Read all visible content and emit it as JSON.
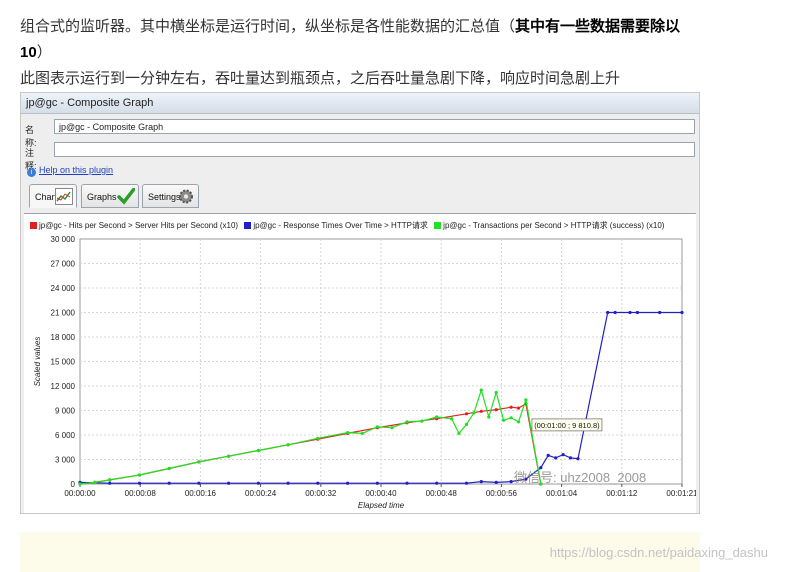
{
  "article": {
    "line1_pre": "组合式的监听器。其中横坐标是运行时间，纵坐标是各性能数据的汇总值（",
    "line1_bold": "其中有一些数据需要除以10",
    "line1_post": "）",
    "line2": "此图表示运行到一分钟左右，吞吐量达到瓶颈点，之后吞吐量急剧下降，响应时间急剧上升"
  },
  "window": {
    "title": "jp@gc - Composite Graph",
    "name_label": "名称:",
    "name_value": "jp@gc - Composite Graph",
    "comment_label": "注释:",
    "comment_value": "",
    "help_link": "Help on this plugin",
    "tabs": [
      {
        "label": "Chart",
        "icon": "chart-icon",
        "active": true
      },
      {
        "label": "Graphs",
        "icon": "checkmark-icon",
        "active": false
      },
      {
        "label": "Settings",
        "icon": "gear-icon",
        "active": false
      }
    ]
  },
  "chart_data": {
    "type": "line",
    "legend": [
      {
        "name": "jp@gc - Hits per Second > Server Hits per Second (x10)",
        "color": "#e02020"
      },
      {
        "name": "jp@gc - Response Times Over Time > HTTP请求",
        "color": "#2020c8"
      },
      {
        "name": "jp@gc - Transactions per Second > HTTP请求 (success) (x10)",
        "color": "#20e020"
      }
    ],
    "ylabel": "Scaled values",
    "xlabel": "Elapsed time",
    "ylim": [
      0,
      30000
    ],
    "yticks": [
      "0",
      "3 000",
      "6 000",
      "9 000",
      "12 000",
      "15 000",
      "18 000",
      "21 000",
      "24 000",
      "27 000",
      "30 000"
    ],
    "xticks": [
      "00:00:00",
      "00:00:08",
      "00:00:16",
      "00:00:24",
      "00:00:32",
      "00:00:40",
      "00:00:48",
      "00:00:56",
      "00:01:04",
      "00:01:12",
      "00:01:21"
    ],
    "xlim_seconds": [
      0,
      81
    ],
    "grid": true,
    "tooltip": "(00:01:00 ; 9 810.8)",
    "series": [
      {
        "name": "jp@gc - Hits per Second > Server Hits per Second (x10)",
        "color": "#e02020",
        "x": [
          0,
          2,
          4,
          8,
          12,
          16,
          20,
          24,
          28,
          32,
          36,
          40,
          44,
          48,
          52,
          54,
          56,
          58,
          59,
          60,
          62
        ],
        "y": [
          0,
          200,
          500,
          1100,
          1900,
          2700,
          3400,
          4100,
          4800,
          5500,
          6200,
          6900,
          7500,
          8000,
          8600,
          8900,
          9100,
          9400,
          9300,
          9810,
          0
        ]
      },
      {
        "name": "jp@gc - Response Times Over Time > HTTP请求",
        "color": "#2020c8",
        "x": [
          0,
          4,
          8,
          12,
          16,
          20,
          24,
          28,
          32,
          36,
          40,
          44,
          48,
          52,
          54,
          56,
          58,
          60,
          62,
          63,
          64,
          65,
          66,
          67,
          71,
          72,
          74,
          75,
          78,
          81
        ],
        "y": [
          200,
          100,
          100,
          100,
          100,
          100,
          100,
          100,
          100,
          100,
          100,
          100,
          100,
          100,
          300,
          200,
          300,
          600,
          2000,
          3500,
          3200,
          3600,
          3200,
          3100,
          21000,
          21000,
          21000,
          21000,
          21000,
          21000
        ]
      },
      {
        "name": "jp@gc - Transactions per Second > HTTP请求 (success) (x10)",
        "color": "#20e020",
        "x": [
          0,
          2,
          4,
          8,
          12,
          16,
          20,
          24,
          28,
          32,
          36,
          38,
          40,
          42,
          44,
          46,
          48,
          50,
          51,
          52,
          53,
          54,
          55,
          56,
          57,
          58,
          59,
          60,
          62
        ],
        "y": [
          0,
          200,
          500,
          1100,
          1900,
          2700,
          3400,
          4100,
          4800,
          5600,
          6300,
          6200,
          7000,
          6900,
          7600,
          7700,
          8200,
          8000,
          6200,
          7300,
          8700,
          11500,
          8200,
          11200,
          7800,
          8100,
          7600,
          10300,
          0
        ]
      }
    ]
  },
  "overlay": {
    "wechat_watermark": "微信号: uhz2008_2008",
    "csdn_watermark": "https://blog.csdn.net/paidaxing_dashu"
  }
}
